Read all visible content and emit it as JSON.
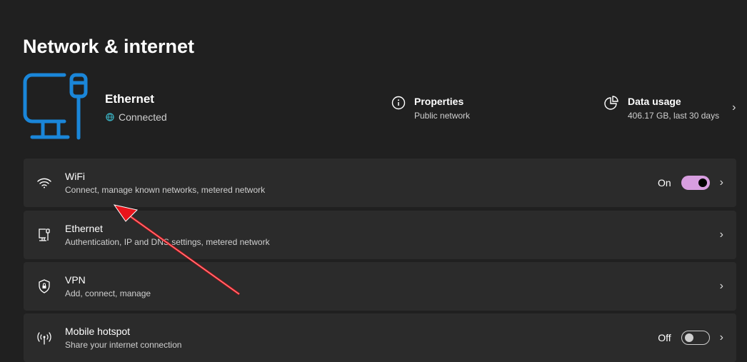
{
  "page_title": "Network & internet",
  "connection": {
    "name": "Ethernet",
    "status": "Connected"
  },
  "properties": {
    "title": "Properties",
    "subtitle": "Public network"
  },
  "data_usage": {
    "title": "Data usage",
    "subtitle": "406.17 GB, last 30 days"
  },
  "items": [
    {
      "title": "WiFi",
      "subtitle": "Connect, manage known networks, metered network",
      "toggle_label": "On",
      "toggle_on": true
    },
    {
      "title": "Ethernet",
      "subtitle": "Authentication, IP and DNS settings, metered network"
    },
    {
      "title": "VPN",
      "subtitle": "Add, connect, manage"
    },
    {
      "title": "Mobile hotspot",
      "subtitle": "Share your internet connection",
      "toggle_label": "Off",
      "toggle_on": false
    }
  ],
  "colors": {
    "accent": "#1a86d9",
    "toggle": "#d89ee0",
    "annotation": "#e8141b"
  }
}
